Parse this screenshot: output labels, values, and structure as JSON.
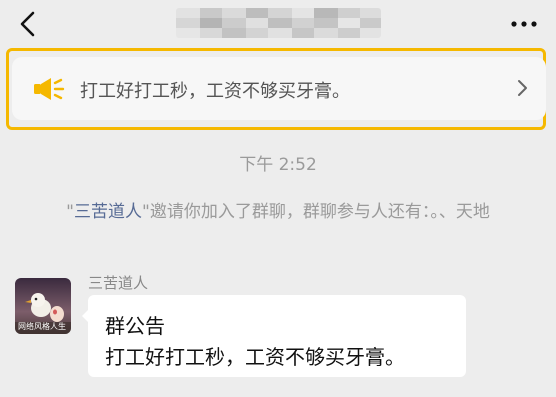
{
  "header": {
    "back_icon": "chevron-left-icon",
    "title": "",
    "more_icon": "more-horizontal-icon"
  },
  "notice": {
    "icon": "speaker-icon",
    "text": "打工好打工秒，工资不够买牙膏。",
    "chevron_icon": "chevron-right-icon",
    "highlight_color": "#f5b800"
  },
  "chat": {
    "timestamp": "下午 2:52",
    "system_message": {
      "quote_open": "\"",
      "inviter": "三苦道人",
      "quote_close": "\"",
      "text": "邀请你加入了群聊，群聊参与人还有：。、天地"
    },
    "message": {
      "sender": "三苦道人",
      "avatar_caption": "网络风格人生",
      "title": "群公告",
      "body": "打工好打工秒，工资不够买牙膏。"
    }
  }
}
